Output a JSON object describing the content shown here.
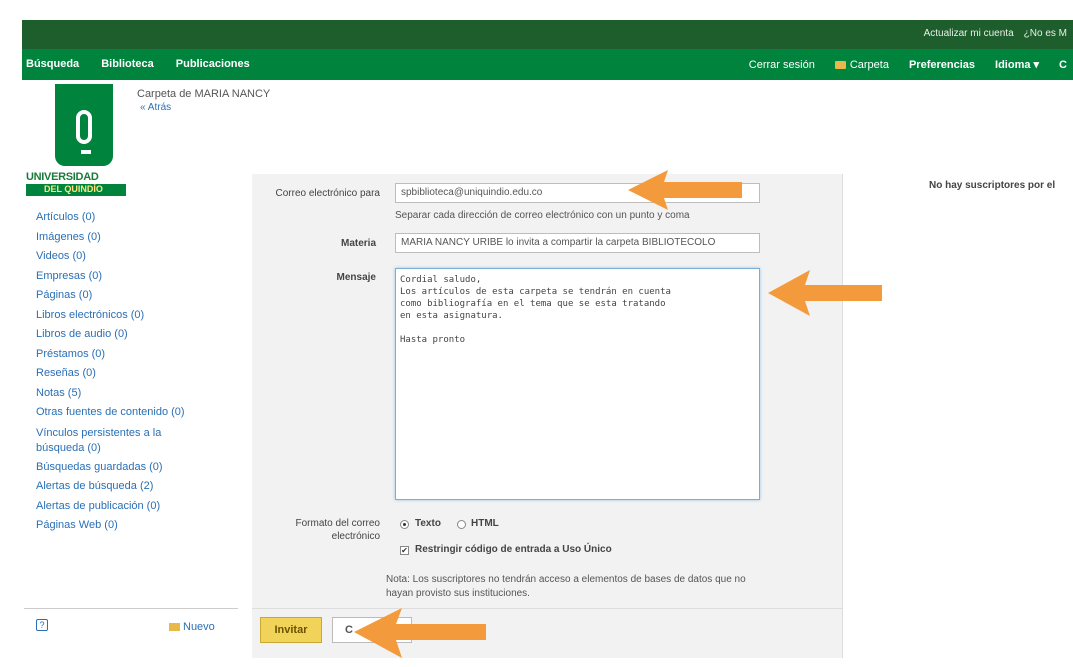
{
  "header": {
    "top_links": [
      "Actualizar mi cuenta",
      "¿No es M"
    ],
    "nav_left": [
      "Búsqueda",
      "Biblioteca",
      "Publicaciones"
    ],
    "nav_right": {
      "logout": "Cerrar sesión",
      "folder": "Carpeta",
      "preferences": "Preferencias",
      "language": "Idioma ▾",
      "cut": "C"
    }
  },
  "brand": {
    "name": "UNIVERSIDAD",
    "sub": "DEL QUINDÍO"
  },
  "folder": {
    "title": "Carpeta de MARIA NANCY",
    "back": "« Atrás"
  },
  "sidebar": {
    "items": [
      "Artículos (0)",
      "Imágenes (0)",
      "Videos (0)",
      "Empresas (0)",
      "Páginas (0)",
      "Libros electrónicos (0)",
      "Libros de audio (0)",
      "Préstamos (0)",
      "Reseñas (0)",
      "Notas (5)",
      "Otras fuentes de contenido (0)",
      "Vínculos persistentes a la búsqueda (0)",
      "Búsquedas guardadas (0)",
      "Alertas de búsqueda (2)",
      "Alertas de publicación (0)",
      "Páginas Web (0)"
    ],
    "new_label": "Nuevo",
    "help": "?"
  },
  "form": {
    "email_label": "Correo electrónico para",
    "email_value": "spbiblioteca@uniquindio.edu.co",
    "email_hint": "Separar cada dirección de correo electrónico con un punto y coma",
    "subject_label": "Materia",
    "subject_value": "MARIA NANCY URIBE lo invita a compartir la carpeta BIBLIOTECOLO",
    "message_label": "Mensaje",
    "message_value": "Cordial saludo,\nLos artículos de esta carpeta se tendrán en cuenta\ncomo bibliografía en el tema que se esta tratando\nen esta asignatura.\n\nHasta pronto",
    "format_label_1": "Formato del correo",
    "format_label_2": "electrónico",
    "format_text": "Texto",
    "format_html": "HTML",
    "restrict_label": "Restringir código de entrada a Uso Único",
    "note_1": "Nota: Los suscriptores no tendrán acceso a elementos de bases de datos que no",
    "note_2": "hayan provisto sus instituciones."
  },
  "actions": {
    "invite": "Invitar",
    "cancel": "C"
  },
  "right_panel": {
    "no_subscribers": "No hay suscriptores por el"
  },
  "colors": {
    "nav_green": "#00843d",
    "top_green": "#1d5e2c",
    "arrow": "#f39a3c",
    "button": "#f1d35a"
  }
}
